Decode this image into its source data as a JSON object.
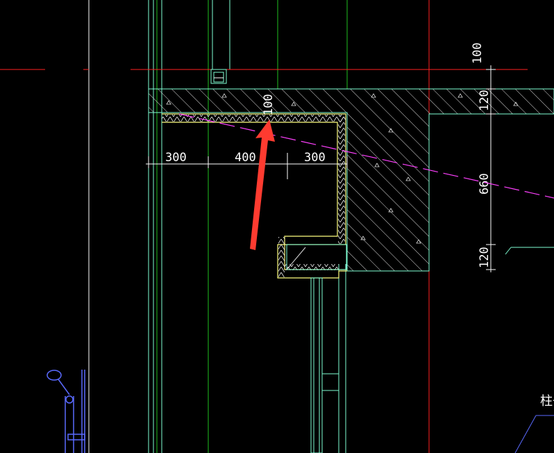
{
  "drawing": {
    "dimensions": {
      "horizontal": [
        "300",
        "400",
        "300"
      ],
      "vertical": [
        "100",
        "120",
        "660",
        "120"
      ],
      "slab_thickness": "100"
    },
    "partial_label": "柱子"
  },
  "colors": {
    "background": "#000000",
    "axis_line": "#ff2020",
    "wall_line": "#7fffd4",
    "grid_line": "#20c020",
    "insulation": "#ffff80",
    "hatch": "#e0e0e0",
    "slope_line": "#ff40ff",
    "annotation_arrow": "#ff3b30",
    "detail_blue": "#5a6aff"
  }
}
